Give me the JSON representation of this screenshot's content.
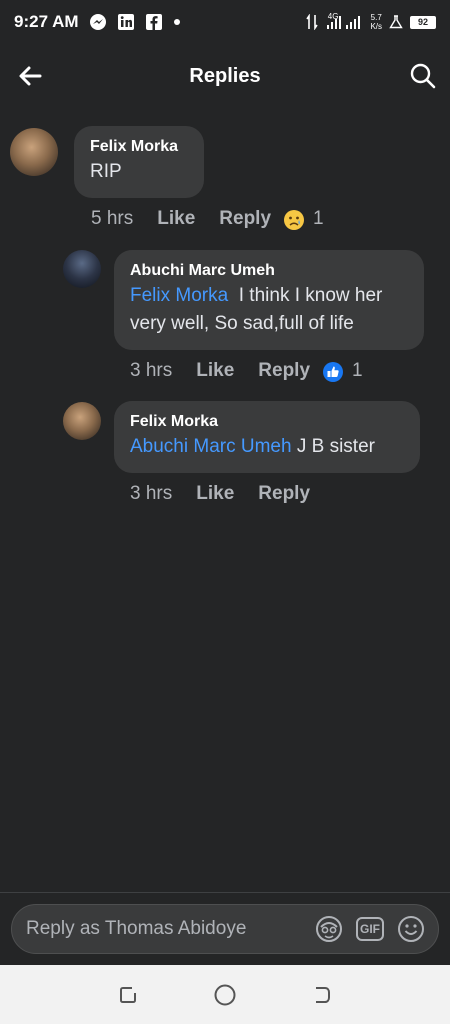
{
  "status_bar": {
    "time": "9:27 AM",
    "network_label": "4G",
    "speed_value": "5.7",
    "speed_unit": "K/s",
    "battery": "92"
  },
  "header": {
    "title": "Replies"
  },
  "comments": [
    {
      "author": "Felix Morka",
      "mention": "",
      "text": "RIP",
      "time": "5 hrs",
      "like_label": "Like",
      "reply_label": "Reply",
      "reaction": "sad-reaction",
      "reaction_count": "1"
    },
    {
      "author": "Abuchi Marc Umeh",
      "mention": "Felix Morka",
      "text": "I think I know her very well, So sad,full of life",
      "time": "3 hrs",
      "like_label": "Like",
      "reply_label": "Reply",
      "reaction": "like-reaction",
      "reaction_count": "1"
    },
    {
      "author": "Felix Morka",
      "mention": "Abuchi Marc Umeh",
      "text": "J B sister",
      "time": "3 hrs",
      "like_label": "Like",
      "reply_label": "Reply",
      "reaction": "",
      "reaction_count": ""
    }
  ],
  "composer": {
    "placeholder": "Reply as Thomas Abidoye",
    "gif_label": "GIF"
  },
  "colors": {
    "background": "#242526",
    "bubble": "#3a3b3c",
    "mention": "#4599ff",
    "like_reaction": "#1877f2"
  }
}
